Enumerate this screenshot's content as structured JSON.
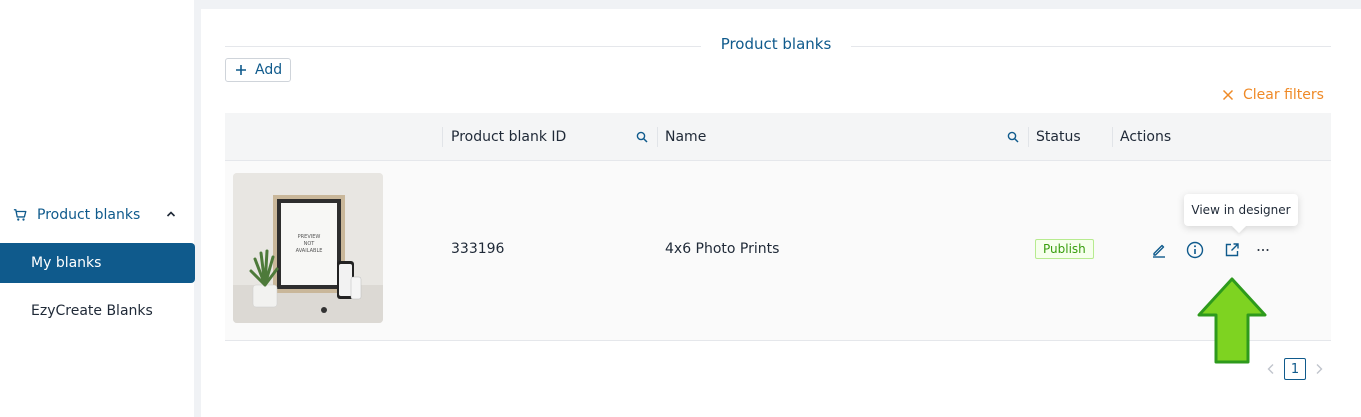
{
  "sidebar": {
    "group_label": "Product blanks",
    "items": [
      {
        "label": "My blanks",
        "active": true
      },
      {
        "label": "EzyCreate Blanks",
        "active": false
      }
    ]
  },
  "main": {
    "title": "Product blanks",
    "add_label": "Add",
    "clear_filters_label": "Clear filters",
    "table": {
      "columns": [
        "Product blank ID",
        "Name",
        "Status",
        "Actions"
      ],
      "rows": [
        {
          "id": "333196",
          "name": "4x6 Photo Prints",
          "status": "Publish",
          "thumb_text": "PREVIEW NOT AVAILABLE"
        }
      ]
    },
    "tooltip": "View in designer",
    "pagination": {
      "current": "1"
    }
  },
  "colors": {
    "primary": "#0f5a8c",
    "accent_orange": "#ef8a27",
    "status_green": "#389e0d",
    "arrow_green": "#7ed321"
  },
  "icons": [
    "cart-icon",
    "chevron-up-icon",
    "plus-icon",
    "close-icon",
    "search-icon",
    "edit-icon",
    "info-icon",
    "external-link-icon",
    "more-icon",
    "chevron-left-icon",
    "chevron-right-icon"
  ]
}
